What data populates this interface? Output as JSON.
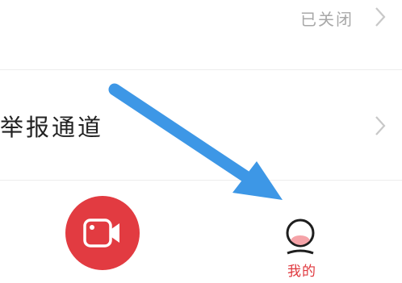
{
  "settings": {
    "status_row": {
      "value": "已关闭",
      "chevron_icon": "chevron-right-icon"
    },
    "report_row": {
      "label": "举报通道",
      "chevron_icon": "chevron-right-icon"
    }
  },
  "tabbar": {
    "record_button": {
      "icon": "video-camera-icon",
      "color": "#e23b41"
    },
    "profile_tab": {
      "label": "我的",
      "icon": "user-avatar-icon",
      "label_color": "#e0383e"
    }
  },
  "annotation": {
    "arrow_color": "#3d97e6",
    "arrow_icon": "pointer-arrow-icon"
  }
}
